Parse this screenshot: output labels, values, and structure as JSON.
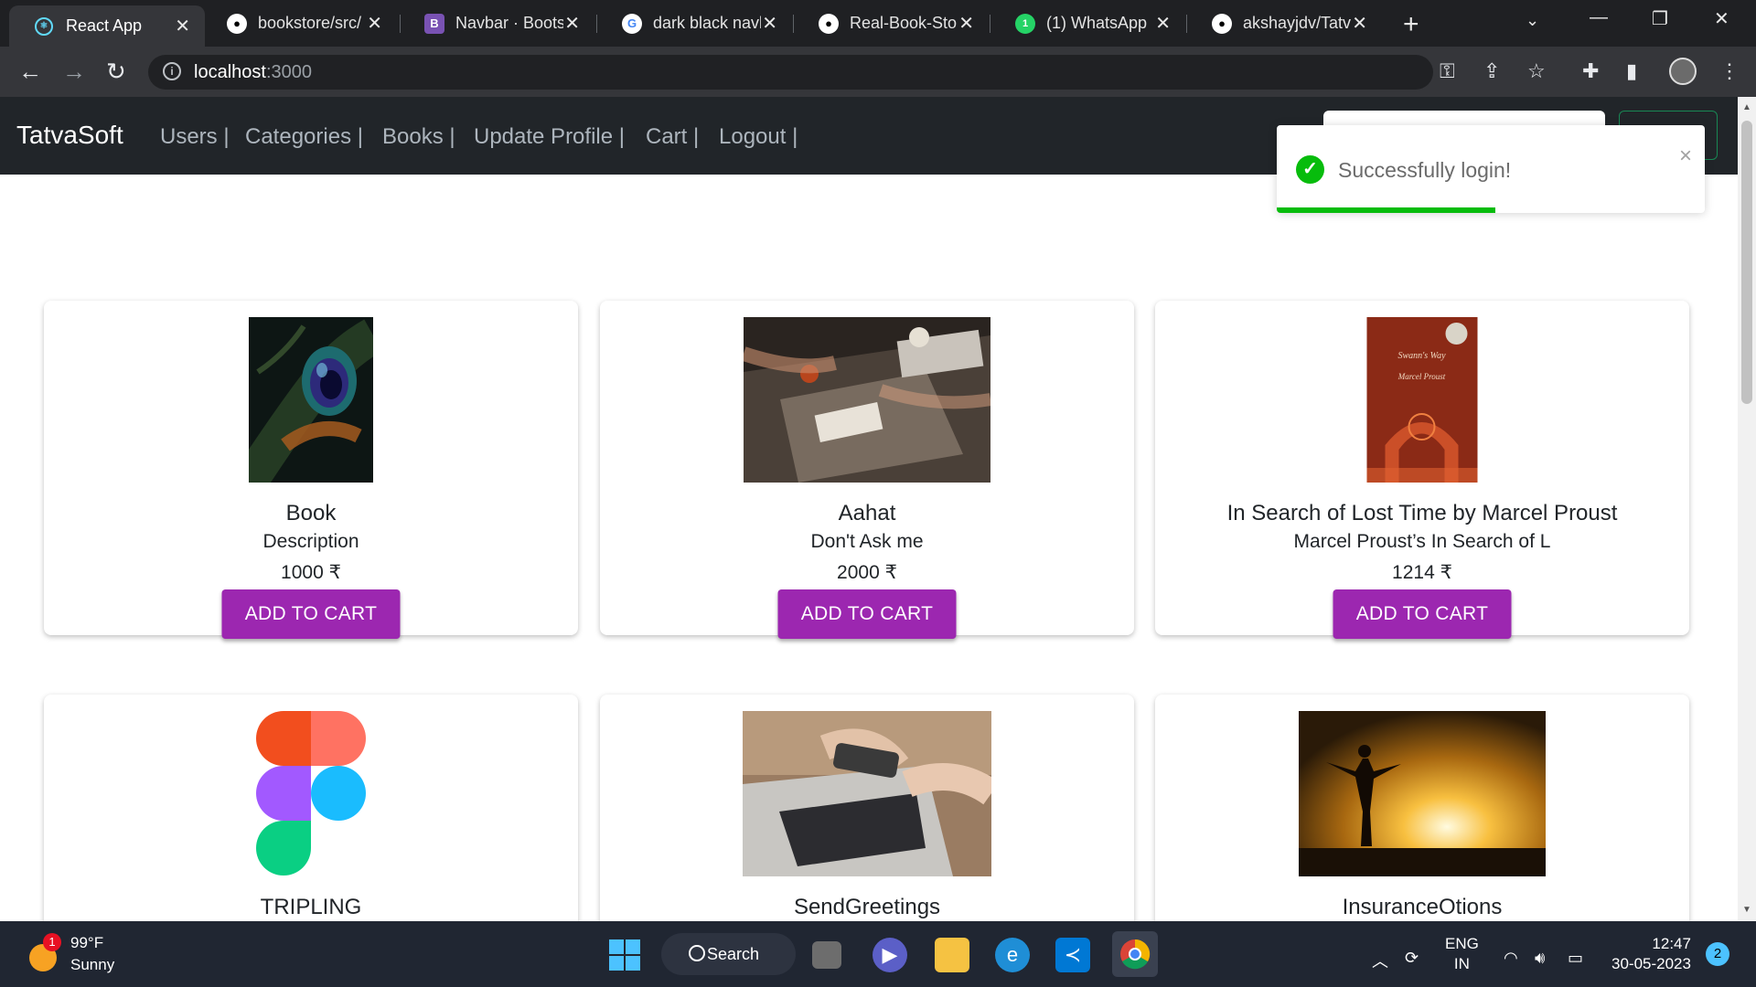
{
  "browser": {
    "tabs": [
      {
        "title": "React App",
        "icon": "react-icon"
      },
      {
        "title": "bookstore/src/",
        "icon": "github-icon"
      },
      {
        "title": "Navbar · Boots",
        "icon": "bootstrap-icon"
      },
      {
        "title": "dark black navl",
        "icon": "google-icon"
      },
      {
        "title": "Real-Book-Stor",
        "icon": "github-icon"
      },
      {
        "title": "(1) WhatsApp",
        "icon": "whatsapp-icon"
      },
      {
        "title": "akshayjdv/Tatv",
        "icon": "github-icon"
      }
    ],
    "url_host": "localhost",
    "url_port": ":3000"
  },
  "navbar": {
    "brand": "TatvaSoft",
    "links": [
      "Users |",
      "Categories |",
      "Books |",
      "Update Profile |",
      "Cart |",
      "Logout |"
    ]
  },
  "toast": {
    "message": "Successfully login!",
    "close": "×",
    "progress": 0.51
  },
  "books": [
    {
      "title": "Book",
      "description": "Description",
      "price": "1000 ₹",
      "button": "ADD TO CART",
      "image": "peacock-feather"
    },
    {
      "title": "Aahat",
      "description": "Don't Ask me",
      "price": "2000 ₹",
      "button": "ADD TO CART",
      "image": "table-laptops"
    },
    {
      "title": "In Search of Lost Time by Marcel Proust",
      "description": "Marcel Proust’s In Search of L",
      "price": "1214 ₹",
      "button": "ADD TO CART",
      "image": "swanns-way-cover"
    },
    {
      "title": "TRIPLING",
      "image": "figma-logo"
    },
    {
      "title": "SendGreetings",
      "image": "phone-laptop"
    },
    {
      "title": "InsuranceOtions",
      "image": "sunset-silhouette"
    }
  ],
  "cover_text": {
    "line1": "Swann's Way",
    "line2": "Marcel Proust"
  },
  "taskbar": {
    "weather_badge": "1",
    "temperature": "99°F",
    "condition": "Sunny",
    "search": "Search",
    "lang1": "ENG",
    "lang2": "IN",
    "time": "12:47",
    "date": "30-05-2023",
    "notifications": "2"
  },
  "colors": {
    "accent_button": "#9c27b0",
    "navbar": "#212529",
    "toast_success": "#07bc0c"
  }
}
